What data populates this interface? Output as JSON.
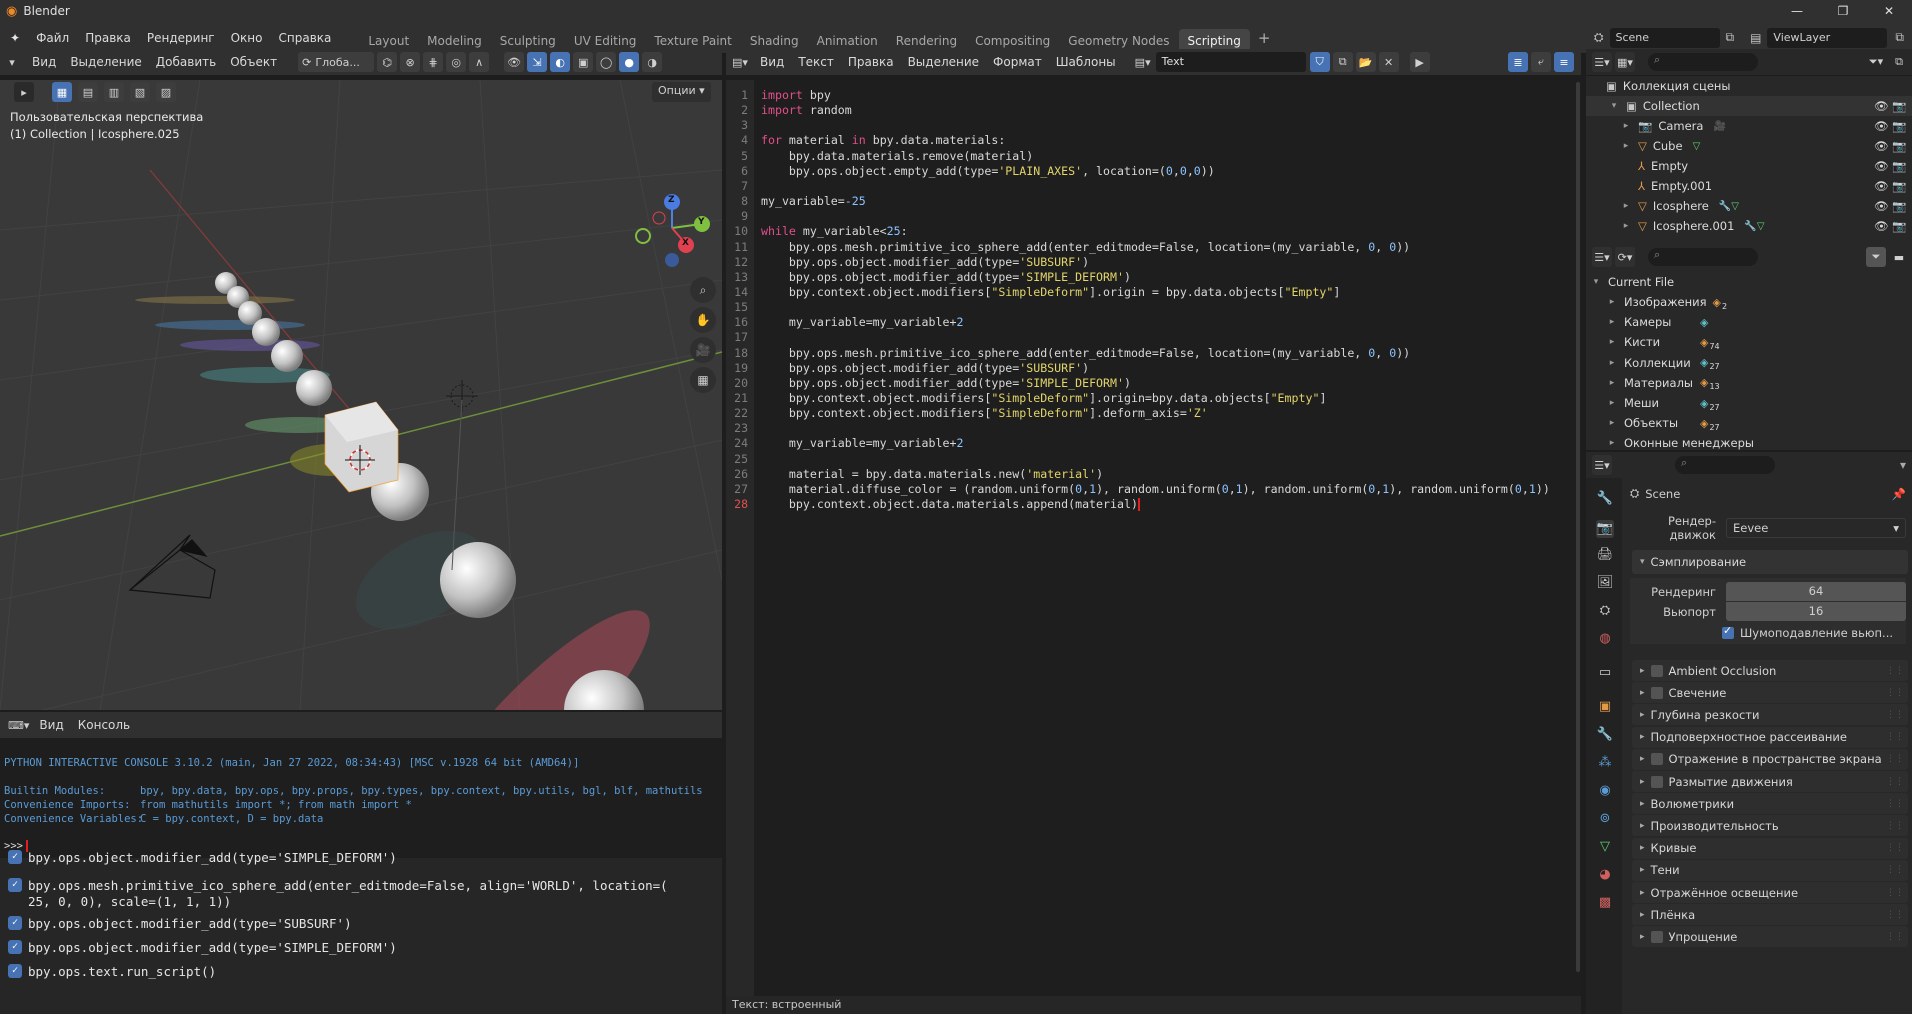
{
  "app_title": "Blender",
  "menus": [
    "Файл",
    "Правка",
    "Рендеринг",
    "Окно",
    "Справка"
  ],
  "workspaces": [
    "Layout",
    "Modeling",
    "Sculpting",
    "UV Editing",
    "Texture Paint",
    "Shading",
    "Animation",
    "Rendering",
    "Compositing",
    "Geometry Nodes",
    "Scripting"
  ],
  "active_workspace": "Scripting",
  "scene_name": "Scene",
  "view_layer": "ViewLayer",
  "viewport": {
    "menus": [
      "Вид",
      "Выделение",
      "Добавить",
      "Объект"
    ],
    "transform": "Глоба...",
    "options_label": "Опции",
    "info_line1": "Пользовательская перспектива",
    "info_line2": "(1) Collection | Icosphere.025",
    "gizmo": {
      "x": "X",
      "y": "Y",
      "z": "Z"
    }
  },
  "text_editor": {
    "menus": [
      "Вид",
      "Текст",
      "Правка",
      "Выделение",
      "Формат",
      "Шаблоны"
    ],
    "file_name": "Text",
    "status": "Текст: встроенный",
    "current_line": 28,
    "lines": [
      "import bpy",
      "import random",
      "",
      "for material in bpy.data.materials:",
      "    bpy.data.materials.remove(material)",
      "    bpy.ops.object.empty_add(type='PLAIN_AXES', location=(0,0,0))",
      "",
      "my_variable=-25",
      "",
      "while my_variable<25:",
      "    bpy.ops.mesh.primitive_ico_sphere_add(enter_editmode=False, location=(my_variable, 0, 0))",
      "    bpy.ops.object.modifier_add(type='SUBSURF')",
      "    bpy.ops.object.modifier_add(type='SIMPLE_DEFORM')",
      "    bpy.context.object.modifiers[\"SimpleDeform\"].origin = bpy.data.objects[\"Empty\"]",
      "",
      "    my_variable=my_variable+2",
      "",
      "    bpy.ops.mesh.primitive_ico_sphere_add(enter_editmode=False, location=(my_variable, 0, 0))",
      "    bpy.ops.object.modifier_add(type='SUBSURF')",
      "    bpy.ops.object.modifier_add(type='SIMPLE_DEFORM')",
      "    bpy.context.object.modifiers[\"SimpleDeform\"].origin=bpy.data.objects[\"Empty\"]",
      "    bpy.context.object.modifiers[\"SimpleDeform\"].deform_axis='Z'",
      "",
      "    my_variable=my_variable+2",
      "",
      "    material = bpy.data.materials.new('material')",
      "    material.diffuse_color = (random.uniform(0,1), random.uniform(0,1), random.uniform(0,1), random.uniform(0,1))",
      "    bpy.context.object.data.materials.append(material)"
    ]
  },
  "console": {
    "menus": [
      "Вид",
      "Консоль"
    ],
    "header_line": "PYTHON INTERACTIVE CONSOLE 3.10.2 (main, Jan 27 2022, 08:34:43) [MSC v.1928 64 bit (AMD64)]",
    "builtin_label": "Builtin Modules:",
    "builtin_value": "bpy, bpy.data, bpy.ops, bpy.props, bpy.types, bpy.context, bpy.utils, bgl, blf, mathutils",
    "imports_label": "Convenience Imports:",
    "imports_value": "from mathutils import *; from math import *",
    "vars_label": "Convenience Variables:",
    "vars_value": "C = bpy.context, D = bpy.data",
    "prompt": ">>>",
    "history": [
      "bpy.ops.object.modifier_add(type='SIMPLE_DEFORM')",
      "bpy.ops.mesh.primitive_ico_sphere_add(enter_editmode=False, align='WORLD', location=(",
      "25, 0, 0), scale=(1, 1, 1))",
      "bpy.ops.object.modifier_add(type='SUBSURF')",
      "bpy.ops.object.modifier_add(type='SIMPLE_DEFORM')",
      "bpy.ops.text.run_script()"
    ]
  },
  "outliner": {
    "root": "Коллекция сцены",
    "collection": "Collection",
    "items": [
      "Camera",
      "Cube",
      "Empty",
      "Empty.001",
      "Icosphere",
      "Icosphere.001"
    ]
  },
  "file_view": {
    "root": "Current File",
    "items": [
      {
        "label": "Изображения",
        "count": "2"
      },
      {
        "label": "Камеры",
        "count": ""
      },
      {
        "label": "Кисти",
        "count": "74"
      },
      {
        "label": "Коллекции",
        "count": "27"
      },
      {
        "label": "Материалы",
        "count": "13"
      },
      {
        "label": "Меши",
        "count": "27"
      },
      {
        "label": "Объекты",
        "count": "27"
      },
      {
        "label": "Оконные менеджеры",
        "count": ""
      }
    ]
  },
  "properties": {
    "scene": "Scene",
    "engine_label": "Рендер-движок",
    "engine_value": "Eevee",
    "sampling": "Сэмплирование",
    "render_label": "Рендеринг",
    "render_value": "64",
    "viewport_label": "Вьюпорт",
    "viewport_value": "16",
    "denoise": "Шумоподавление вьюп...",
    "panels": [
      {
        "label": "Ambient Occlusion",
        "check": true
      },
      {
        "label": "Свечение",
        "check": true
      },
      {
        "label": "Глубина резкости",
        "check": false
      },
      {
        "label": "Подповерхностное рассеивание",
        "check": false
      },
      {
        "label": "Отражение в пространстве экрана",
        "check": true
      },
      {
        "label": "Размытие движения",
        "check": true
      },
      {
        "label": "Волюметрики",
        "check": false
      },
      {
        "label": "Производительность",
        "check": false
      },
      {
        "label": "Кривые",
        "check": false
      },
      {
        "label": "Тени",
        "check": false
      },
      {
        "label": "Отражённое освещение",
        "check": false
      },
      {
        "label": "Плёнка",
        "check": false
      },
      {
        "label": "Упрощение",
        "check": true
      }
    ]
  },
  "colors": {
    "accent": "#4772b3",
    "keyword": "#e0508a",
    "string": "#e2d46a",
    "number": "#8bc4ff",
    "console_blue": "#5b9bd5"
  }
}
